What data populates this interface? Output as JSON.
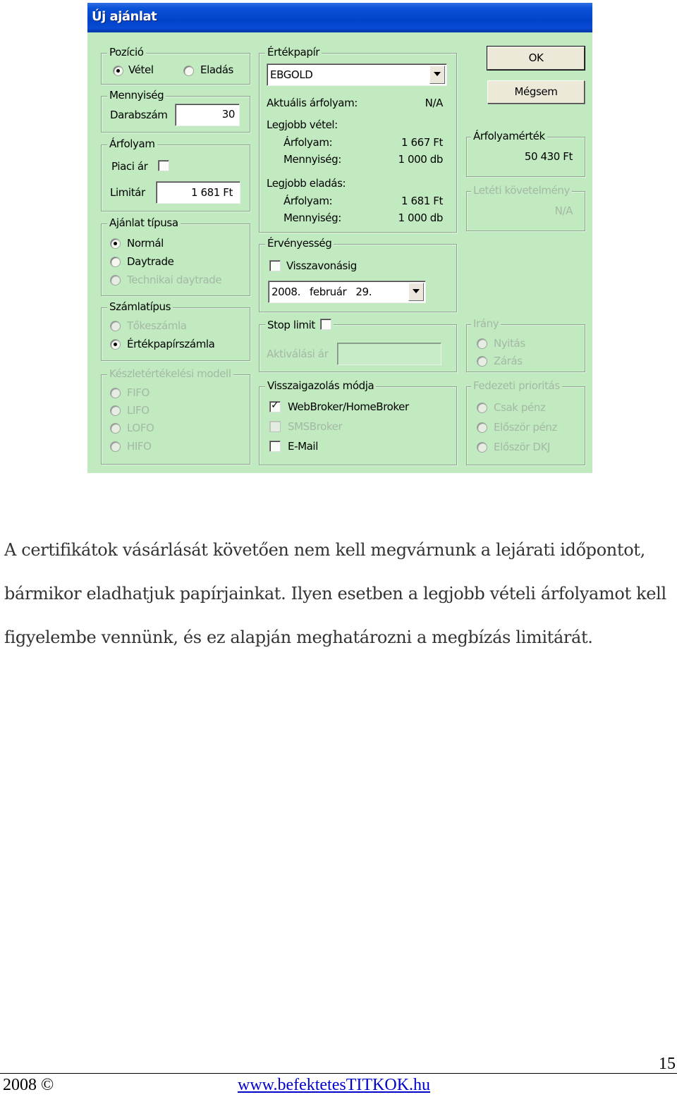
{
  "dialog": {
    "title": "Új ajánlat",
    "buttons": {
      "ok": "OK",
      "cancel": "Mégsem"
    },
    "position": {
      "legend": "Pozíció",
      "options": [
        {
          "label": "Vétel",
          "selected": true,
          "enabled": true
        },
        {
          "label": "Eladás",
          "selected": false,
          "enabled": true
        }
      ]
    },
    "quantity": {
      "legend": "Mennyiség",
      "label": "Darabszám",
      "value": "30"
    },
    "price": {
      "legend": "Árfolyam",
      "market_price_label": "Piaci ár",
      "market_price_checked": false,
      "limit_label": "Limitár",
      "limit_value": "1 681  Ft"
    },
    "order_type": {
      "legend": "Ajánlat típusa",
      "options": [
        {
          "label": "Normál",
          "selected": true,
          "enabled": true
        },
        {
          "label": "Daytrade",
          "selected": false,
          "enabled": true
        },
        {
          "label": "Technikai daytrade",
          "selected": false,
          "enabled": false
        }
      ]
    },
    "account_type": {
      "legend": "Számlatípus",
      "options": [
        {
          "label": "Tőkeszámla",
          "selected": false,
          "enabled": false
        },
        {
          "label": "Értékpapírszámla",
          "selected": true,
          "enabled": true
        }
      ]
    },
    "inventory_model": {
      "legend": "Készletértékelési modell",
      "enabled": false,
      "options": [
        {
          "label": "FIFO",
          "selected": false
        },
        {
          "label": "LIFO",
          "selected": false
        },
        {
          "label": "LOFO",
          "selected": false
        },
        {
          "label": "HIFO",
          "selected": false
        }
      ]
    },
    "security": {
      "legend": "Értékpapír",
      "selected": "EBGOLD",
      "current_price_label": "Aktuális árfolyam:",
      "current_price_value": "N/A",
      "best_bid_label": "Legjobb vétel:",
      "best_bid_price_label": "Árfolyam:",
      "best_bid_price": "1 667 Ft",
      "best_bid_qty_label": "Mennyiség:",
      "best_bid_qty": "1 000 db",
      "best_ask_label": "Legjobb eladás:",
      "best_ask_price_label": "Árfolyam:",
      "best_ask_price": "1 681 Ft",
      "best_ask_qty_label": "Mennyiség:",
      "best_ask_qty": "1 000 db"
    },
    "validity": {
      "legend": "Érvényesség",
      "until_cancel_label": "Visszavonásig",
      "until_cancel_checked": false,
      "date_value": "2008.   február   29."
    },
    "stop_limit": {
      "legend": "Stop limit",
      "checked": false,
      "activation_label": "Aktiválási ár",
      "activation_value": ""
    },
    "confirmation": {
      "legend": "Visszaigazolás módja",
      "options": [
        {
          "label": "WebBroker/HomeBroker",
          "checked": true,
          "enabled": true
        },
        {
          "label": "SMSBroker",
          "checked": false,
          "enabled": false
        },
        {
          "label": "E-Mail",
          "checked": false,
          "enabled": true
        }
      ]
    },
    "price_value": {
      "legend": "Árfolyamérték",
      "value": "50 430 Ft"
    },
    "margin_requirement": {
      "legend": "Letéti követelmény",
      "value": "N/A",
      "enabled": false
    },
    "direction": {
      "legend": "Irány",
      "enabled": false,
      "options": [
        {
          "label": "Nyitás",
          "selected": false
        },
        {
          "label": "Zárás",
          "selected": false
        }
      ]
    },
    "coverage_priority": {
      "legend": "Fedezeti prioritás",
      "enabled": false,
      "options": [
        {
          "label": "Csak pénz",
          "selected": false
        },
        {
          "label": "Először pénz",
          "selected": false
        },
        {
          "label": "Először DKJ",
          "selected": false
        }
      ]
    }
  },
  "document": {
    "paragraph_lines": [
      "A certifikátok vásárlását követően nem kell megvárnunk a lejárati időpontot,",
      "bármikor eladhatjuk papírjainkat. Ilyen esetben a legjobb vételi árfolyamot kell",
      "figyelembe vennünk, és ez alapján meghatározni a megbízás limitárát."
    ],
    "page_number": "15",
    "footer_left": "2008 ©",
    "footer_link": "www.befektetesTITKOK.hu"
  }
}
